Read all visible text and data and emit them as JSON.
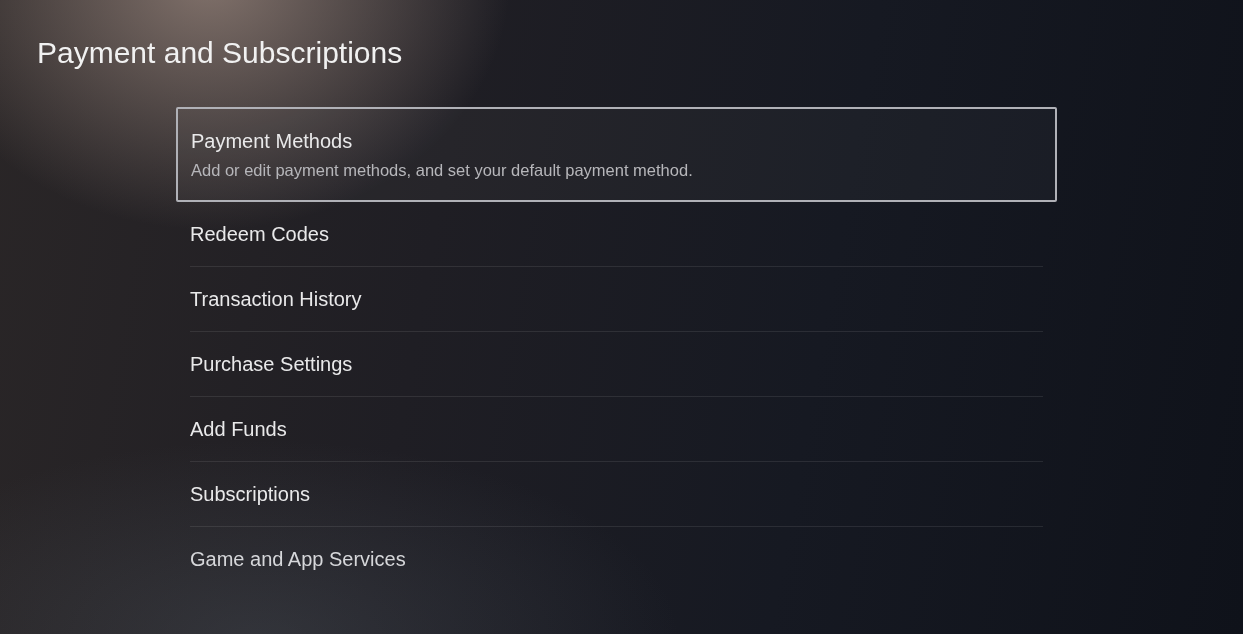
{
  "title": "Payment and Subscriptions",
  "items": [
    {
      "label": "Payment Methods",
      "description": "Add or edit payment methods, and set your default payment method.",
      "selected": true
    },
    {
      "label": "Redeem Codes",
      "selected": false
    },
    {
      "label": "Transaction History",
      "selected": false
    },
    {
      "label": "Purchase Settings",
      "selected": false
    },
    {
      "label": "Add Funds",
      "selected": false
    },
    {
      "label": "Subscriptions",
      "selected": false
    },
    {
      "label": "Game and App Services",
      "selected": false
    }
  ]
}
